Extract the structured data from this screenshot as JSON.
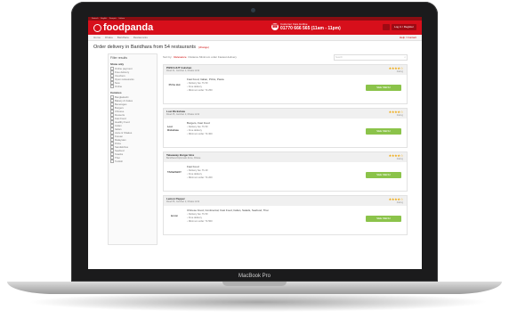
{
  "device": {
    "model_label": "MacBook Pro"
  },
  "site": {
    "topbar": [
      "Deutsch",
      "English",
      "Français",
      "Italiano"
    ],
    "logo": "foodpanda",
    "phone": {
      "sub": "Customer Care Hotline",
      "number": "01770 666 565 (11am - 11pm)"
    },
    "user_button": "Log in / Register",
    "nav": {
      "items": [
        "Home",
        "Dhaka",
        "Baridhara",
        "Restaurants"
      ],
      "right": "Help / Contact"
    },
    "headline": "Order delivery in Baridhara from 54 restaurants",
    "headline_change": "(change)",
    "sidebar": {
      "title": "Filter results",
      "sections": [
        {
          "title": "Show only",
          "items": [
            "Online payment",
            "Free delivery",
            "Vouchers",
            "Open restaurants",
            "New",
            "Online"
          ]
        },
        {
          "title": "Cuisines",
          "items": [
            "Bangladeshi",
            "Bakery & Cakes",
            "Beverages",
            "Burgers",
            "Chinese",
            "Desserts",
            "Fast Food",
            "Healthy Food",
            "Indian",
            "Italian",
            "Juice & Shakes",
            "Korean",
            "Malaysian",
            "Pizza",
            "Sandwiches",
            "Seafood",
            "Snacks",
            "Thai",
            "Turkish"
          ]
        }
      ]
    },
    "sortbar": {
      "label": "Sort by:",
      "selected": "Relevance",
      "others": "Distance  Minimum order  Fastest delivery",
      "search_placeholder": "Search"
    },
    "restaurants": [
      {
        "name": "PIZZA HUT Gulshan",
        "address": "Road 41, Gulshan 2, Dhaka 1212",
        "stars": "★★★★☆",
        "rating": "Rating",
        "thumb": "Pizza Hut",
        "cuisine": "Fast Food, Italian, Pizza, Pasta",
        "delivery": "Delivery fee: Tk 50",
        "free": "Free delivery",
        "min": "Minimum order: Tk 250",
        "button": "SEE MENU"
      },
      {
        "name": "Lost Rickshaw",
        "address": "Road 35, Gulshan 2, Dhaka 1212",
        "stars": "★★★★☆",
        "rating": "Rating",
        "thumb": "Lost Rickshaw",
        "cuisine": "Burgers, Fast Food",
        "delivery": "Delivery fee: Tk 50",
        "free": "Free delivery",
        "min": "Minimum order: Tk 300",
        "button": "SEE MENU"
      },
      {
        "name": "Takeaway Burger Box",
        "address": "Baridhara Diplomatic Zone, Dhaka",
        "stars": "★★★★☆",
        "rating": "Rating",
        "thumb": "TAKEAWAY",
        "cuisine": "Fast Food",
        "delivery": "Delivery fee: Tk 40",
        "free": "Free delivery",
        "min": "Minimum order: Tk 200",
        "button": "SEE MENU"
      },
      {
        "name": "Lemon Pepper",
        "address": "Road 55, Gulshan 2, Dhaka 1212",
        "stars": "★★★★☆",
        "rating": "Rating",
        "thumb": "lemon",
        "cuisine": "Chinese Food, Continental, Fast Food, Italian, Salads, Seafood, Thai",
        "delivery": "Delivery fee: Tk 50",
        "free": "Free delivery",
        "min": "Minimum order: Tk 500",
        "button": "SEE MENU"
      }
    ]
  },
  "colors": {
    "brand": "#d70f1b",
    "order_button": "#8bc34a",
    "stars": "#f0a500"
  }
}
